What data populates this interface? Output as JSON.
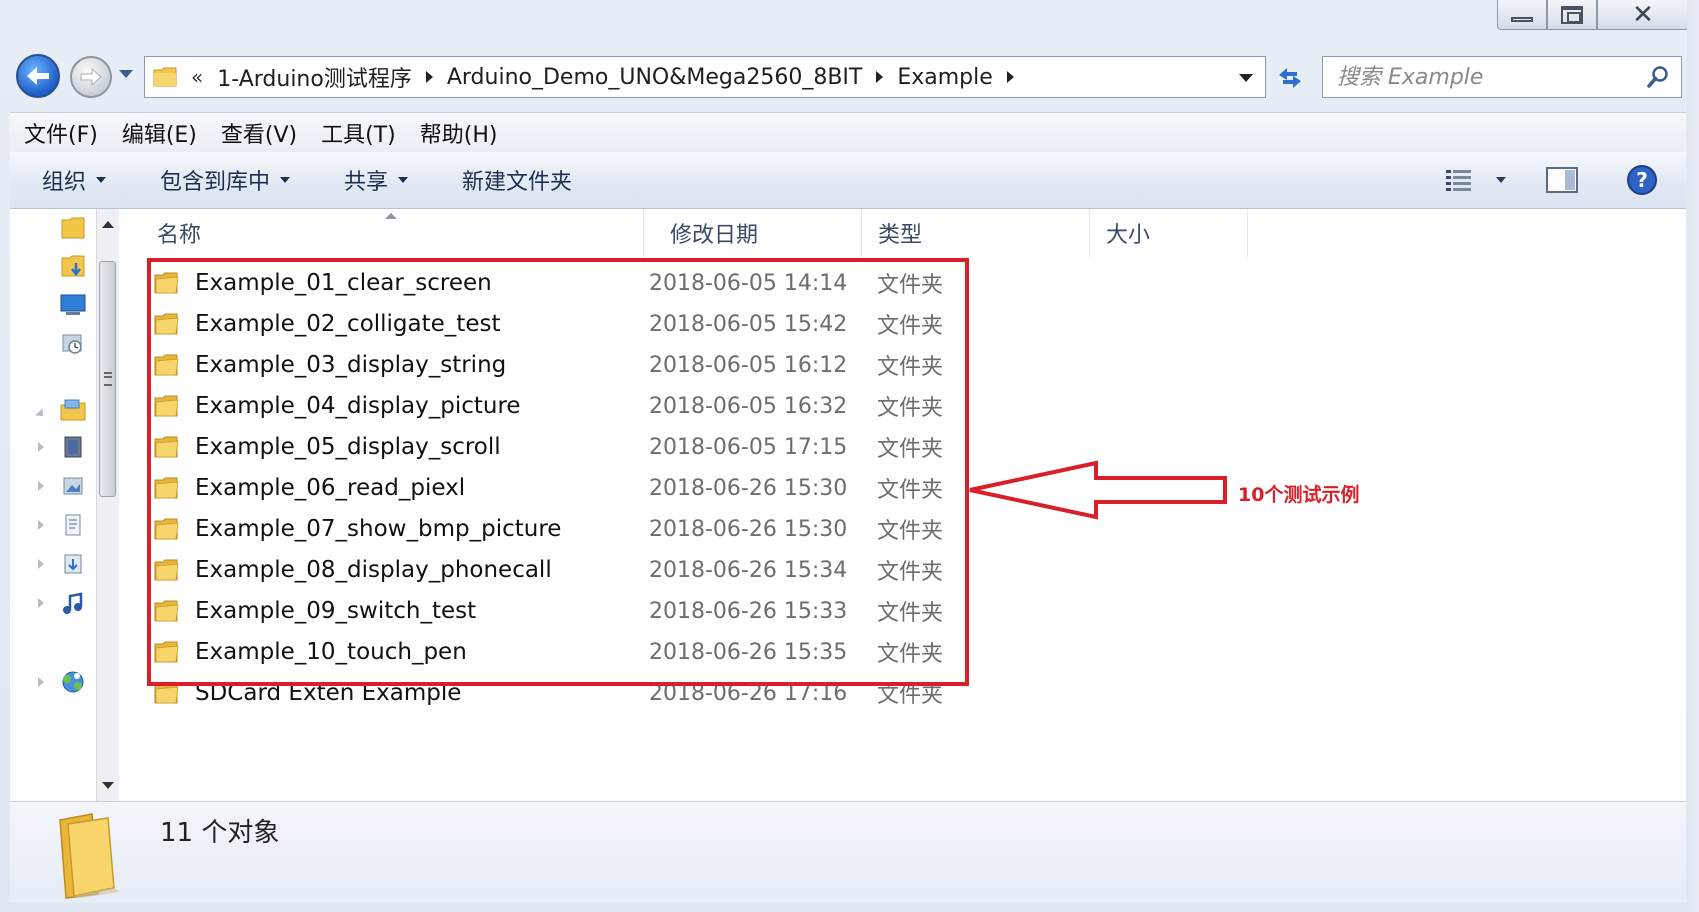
{
  "window": {
    "close_glyph": "✕"
  },
  "nav": {
    "address_overflow": "«",
    "breadcrumbs": [
      "1-Arduino测试程序",
      "Arduino_Demo_UNO&Mega2560_8BIT",
      "Example"
    ],
    "search_placeholder": "搜索 Example"
  },
  "menu": {
    "items": [
      "文件(F)",
      "编辑(E)",
      "查看(V)",
      "工具(T)",
      "帮助(H)"
    ]
  },
  "toolbar": {
    "organize": "组织",
    "include_in_library": "包含到库中",
    "share": "共享",
    "new_folder": "新建文件夹"
  },
  "columns": {
    "name": "名称",
    "date": "修改日期",
    "type": "类型",
    "size": "大小"
  },
  "files": [
    {
      "name": "Example_01_clear_screen",
      "date": "2018-06-05 14:14",
      "type": "文件夹"
    },
    {
      "name": "Example_02_colligate_test",
      "date": "2018-06-05 15:42",
      "type": "文件夹"
    },
    {
      "name": "Example_03_display_string",
      "date": "2018-06-05 16:12",
      "type": "文件夹"
    },
    {
      "name": "Example_04_display_picture",
      "date": "2018-06-05 16:32",
      "type": "文件夹"
    },
    {
      "name": "Example_05_display_scroll",
      "date": "2018-06-05 17:15",
      "type": "文件夹"
    },
    {
      "name": "Example_06_read_piexl",
      "date": "2018-06-26 15:30",
      "type": "文件夹"
    },
    {
      "name": "Example_07_show_bmp_picture",
      "date": "2018-06-26 15:30",
      "type": "文件夹"
    },
    {
      "name": "Example_08_display_phonecall",
      "date": "2018-06-26 15:34",
      "type": "文件夹"
    },
    {
      "name": "Example_09_switch_test",
      "date": "2018-06-26 15:33",
      "type": "文件夹"
    },
    {
      "name": "Example_10_touch_pen",
      "date": "2018-06-26 15:35",
      "type": "文件夹"
    },
    {
      "name": "SDCard Exten Example",
      "date": "2018-06-26 17:16",
      "type": "文件夹"
    }
  ],
  "annotation": {
    "text": "10个测试示例",
    "color": "#d9202a"
  },
  "details": {
    "count": "11 个对象"
  },
  "colors": {
    "folder": "#f2c649",
    "accent": "#1d5fc8"
  }
}
